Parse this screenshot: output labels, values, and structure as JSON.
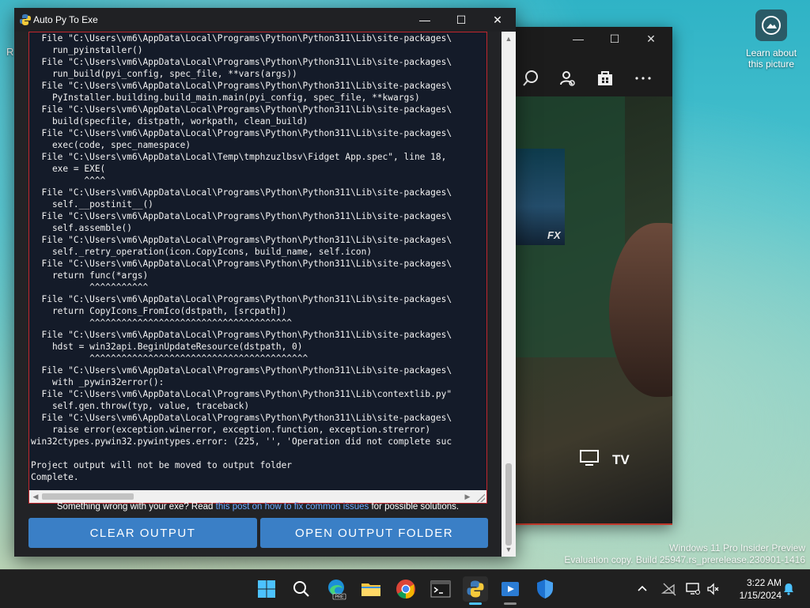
{
  "desktop": {
    "learn_icon_label": "Learn about this picture",
    "edge_letter": "R",
    "watermark_line1": "Windows 11 Pro Insider Preview",
    "watermark_line2": "Evaluation copy. Build 25947.rs_prerelease.230901-1416"
  },
  "bg_app": {
    "tv_label": "TV",
    "fx_label": "FX"
  },
  "window": {
    "title": "Auto Py To Exe",
    "minimize": "—",
    "maximize": "☐",
    "close": "✕"
  },
  "console": {
    "lines": [
      "  File \"C:\\Users\\vm6\\AppData\\Local\\Programs\\Python\\Python311\\Lib\\site-packages\\",
      "    run_pyinstaller()",
      "  File \"C:\\Users\\vm6\\AppData\\Local\\Programs\\Python\\Python311\\Lib\\site-packages\\",
      "    run_build(pyi_config, spec_file, **vars(args))",
      "  File \"C:\\Users\\vm6\\AppData\\Local\\Programs\\Python\\Python311\\Lib\\site-packages\\",
      "    PyInstaller.building.build_main.main(pyi_config, spec_file, **kwargs)",
      "  File \"C:\\Users\\vm6\\AppData\\Local\\Programs\\Python\\Python311\\Lib\\site-packages\\",
      "    build(specfile, distpath, workpath, clean_build)",
      "  File \"C:\\Users\\vm6\\AppData\\Local\\Programs\\Python\\Python311\\Lib\\site-packages\\",
      "    exec(code, spec_namespace)",
      "  File \"C:\\Users\\vm6\\AppData\\Local\\Temp\\tmphzuzlbsv\\Fidget App.spec\", line 18,",
      "    exe = EXE(",
      "          ^^^^",
      "  File \"C:\\Users\\vm6\\AppData\\Local\\Programs\\Python\\Python311\\Lib\\site-packages\\",
      "    self.__postinit__()",
      "  File \"C:\\Users\\vm6\\AppData\\Local\\Programs\\Python\\Python311\\Lib\\site-packages\\",
      "    self.assemble()",
      "  File \"C:\\Users\\vm6\\AppData\\Local\\Programs\\Python\\Python311\\Lib\\site-packages\\",
      "    self._retry_operation(icon.CopyIcons, build_name, self.icon)",
      "  File \"C:\\Users\\vm6\\AppData\\Local\\Programs\\Python\\Python311\\Lib\\site-packages\\",
      "    return func(*args)",
      "           ^^^^^^^^^^^",
      "  File \"C:\\Users\\vm6\\AppData\\Local\\Programs\\Python\\Python311\\Lib\\site-packages\\",
      "    return CopyIcons_FromIco(dstpath, [srcpath])",
      "           ^^^^^^^^^^^^^^^^^^^^^^^^^^^^^^^^^^^^^^",
      "  File \"C:\\Users\\vm6\\AppData\\Local\\Programs\\Python\\Python311\\Lib\\site-packages\\",
      "    hdst = win32api.BeginUpdateResource(dstpath, 0)",
      "           ^^^^^^^^^^^^^^^^^^^^^^^^^^^^^^^^^^^^^^^^^",
      "  File \"C:\\Users\\vm6\\AppData\\Local\\Programs\\Python\\Python311\\Lib\\site-packages\\",
      "    with _pywin32error():",
      "  File \"C:\\Users\\vm6\\AppData\\Local\\Programs\\Python\\Python311\\Lib\\contextlib.py\"",
      "    self.gen.throw(typ, value, traceback)",
      "  File \"C:\\Users\\vm6\\AppData\\Local\\Programs\\Python\\Python311\\Lib\\site-packages\\",
      "    raise error(exception.winerror, exception.function, exception.strerror)",
      "win32ctypes.pywin32.pywintypes.error: (225, '', 'Operation did not complete suc",
      "",
      "Project output will not be moved to output folder",
      "Complete."
    ]
  },
  "hint": {
    "prefix": "Something wrong with your exe? Read ",
    "link": "this post on how to fix common issues",
    "suffix": " for possible solutions."
  },
  "buttons": {
    "clear": "CLEAR OUTPUT",
    "open": "OPEN OUTPUT FOLDER"
  },
  "taskbar": {
    "icons": [
      "start-icon",
      "search-icon",
      "edge-beta-icon",
      "file-explorer-icon",
      "chrome-icon",
      "terminal-icon",
      "python-icon",
      "media-player-icon",
      "defender-icon"
    ],
    "edge_badge": "PRE"
  },
  "clock": {
    "time": "3:22 AM",
    "date": "1/15/2024"
  },
  "colors": {
    "console_bg": "#141b29",
    "console_border": "#c0262d",
    "button": "#3a7fc6",
    "link": "#6ea8ff"
  }
}
